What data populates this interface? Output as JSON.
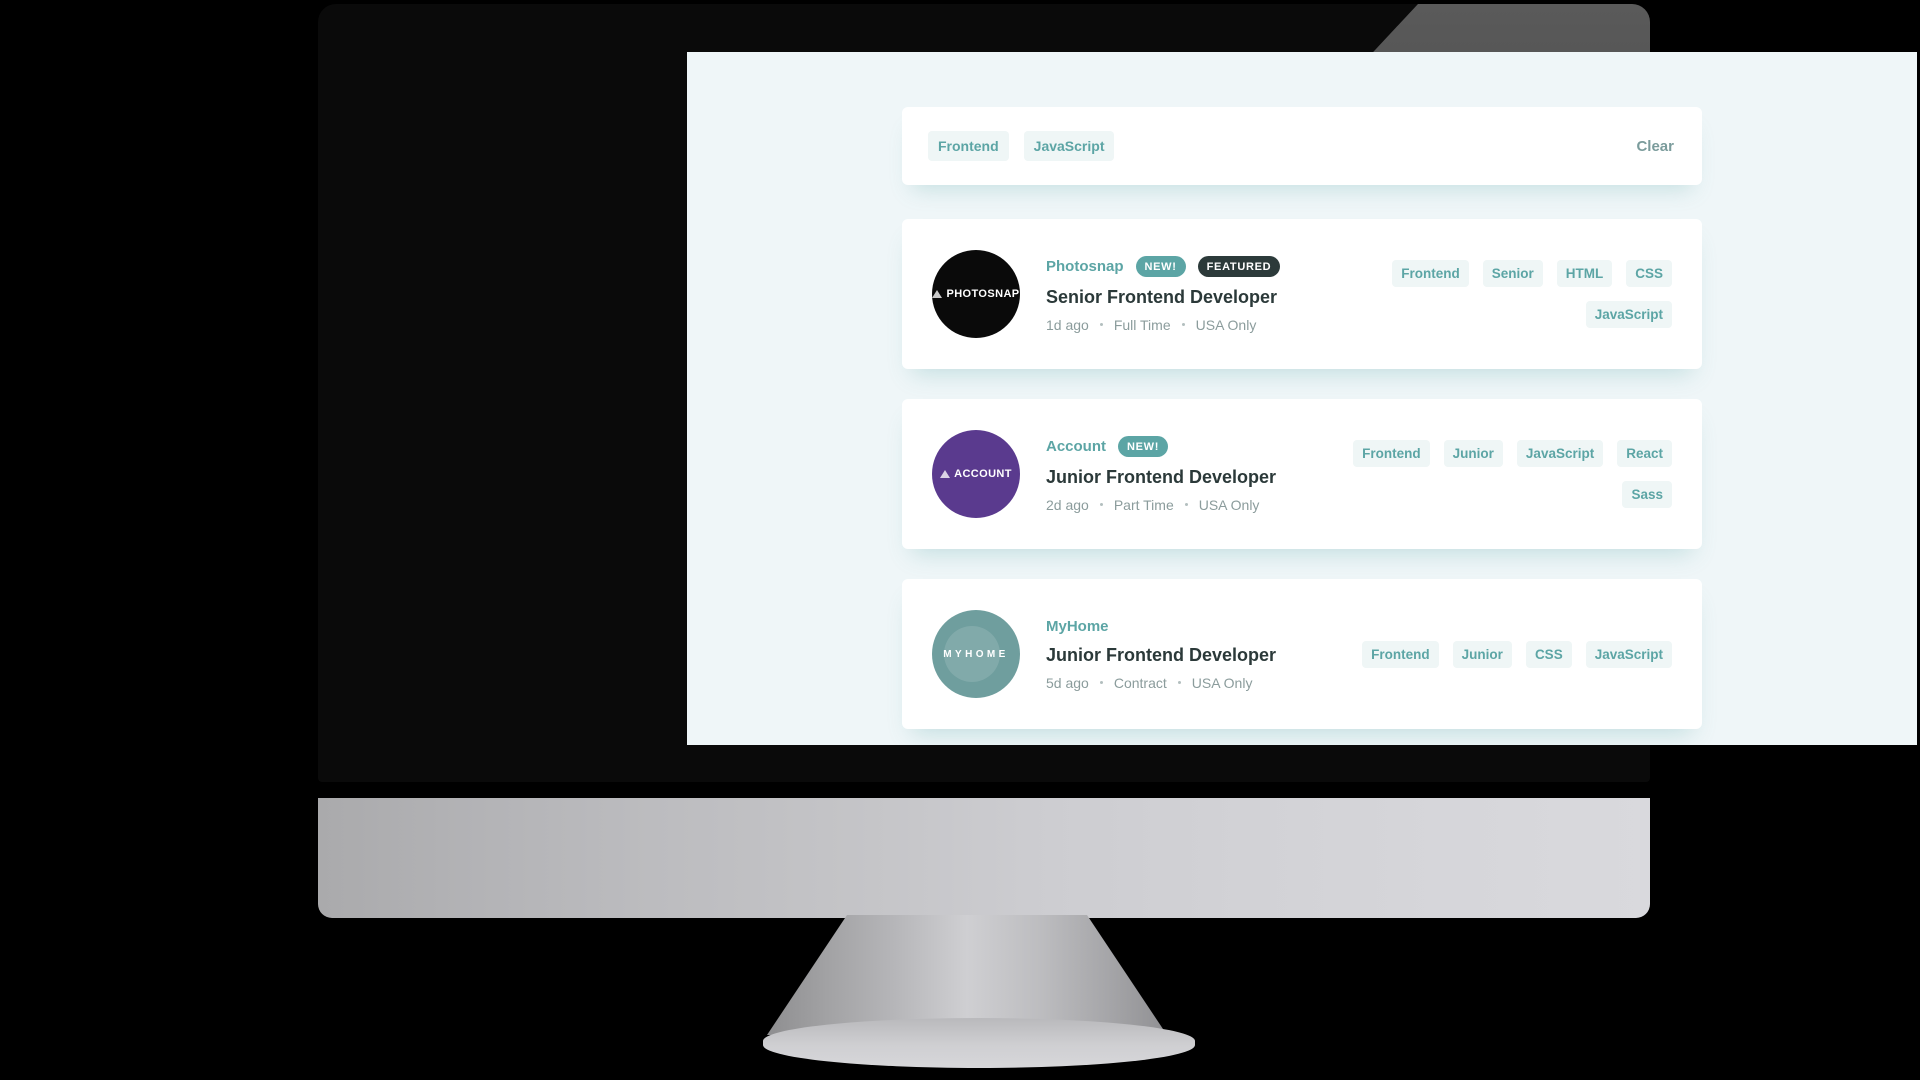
{
  "screen": {
    "background_color": "#eff6f8"
  },
  "theme": {
    "accent": "#5ca5a5",
    "chip_background": "#eff6f6",
    "featured_badge": "#2c3a3a",
    "heading": "#2b3939",
    "meta_text": "#8b9c9c"
  },
  "filter_bar": {
    "tags": [
      {
        "label": "Frontend"
      },
      {
        "label": "JavaScript"
      }
    ],
    "clear_label": "Clear"
  },
  "jobs": [
    {
      "company": "Photosnap",
      "logo_text": "PHOTOSNAP",
      "logo_color": "#0a0a0a",
      "logo_style": "triangle",
      "badges": [
        {
          "label": "NEW!",
          "type": "new"
        },
        {
          "label": "FEATURED",
          "type": "featured"
        }
      ],
      "position": "Senior Frontend Developer",
      "posted_at": "1d ago",
      "contract": "Full Time",
      "location": "USA Only",
      "tags": [
        "Frontend",
        "Senior",
        "HTML",
        "CSS",
        "JavaScript"
      ]
    },
    {
      "company": "Account",
      "logo_text": "ACCOUNT",
      "logo_color": "#5a3a8e",
      "logo_style": "triangle",
      "badges": [
        {
          "label": "NEW!",
          "type": "new"
        }
      ],
      "position": "Junior Frontend Developer",
      "posted_at": "2d ago",
      "contract": "Part Time",
      "location": "USA Only",
      "tags": [
        "Frontend",
        "Junior",
        "JavaScript",
        "React",
        "Sass"
      ]
    },
    {
      "company": "MyHome",
      "logo_text": "MYHOME",
      "logo_color": "#6f9e9e",
      "logo_style": "spaced",
      "badges": [],
      "position": "Junior Frontend Developer",
      "posted_at": "5d ago",
      "contract": "Contract",
      "location": "USA Only",
      "tags": [
        "Frontend",
        "Junior",
        "CSS",
        "JavaScript"
      ]
    },
    {
      "company": "",
      "logo_text": "",
      "logo_color": "#ffffff",
      "logo_style": "none",
      "badges": [],
      "position": "",
      "posted_at": "",
      "contract": "",
      "location": "",
      "tags": []
    }
  ]
}
